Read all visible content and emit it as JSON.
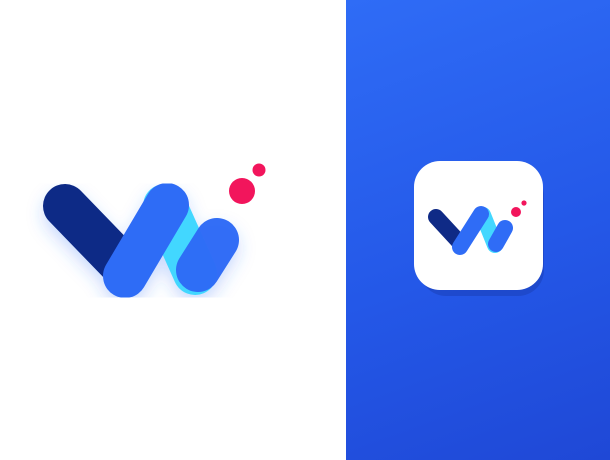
{
  "canvas": {
    "left_background": "#ffffff",
    "right_background_start": "#2f6cf6",
    "right_background_end": "#1f48d6"
  },
  "logo": {
    "icon": "w-logo-icon",
    "colors": {
      "dark_stroke": "#0f2a86",
      "blue_stroke": "#2f6cf6",
      "cyan_stroke": "#43d7ff",
      "pink_dot": "#f2155c"
    }
  },
  "app_icon": {
    "background": "#ffffff",
    "shadow": "#1c3fb8"
  }
}
